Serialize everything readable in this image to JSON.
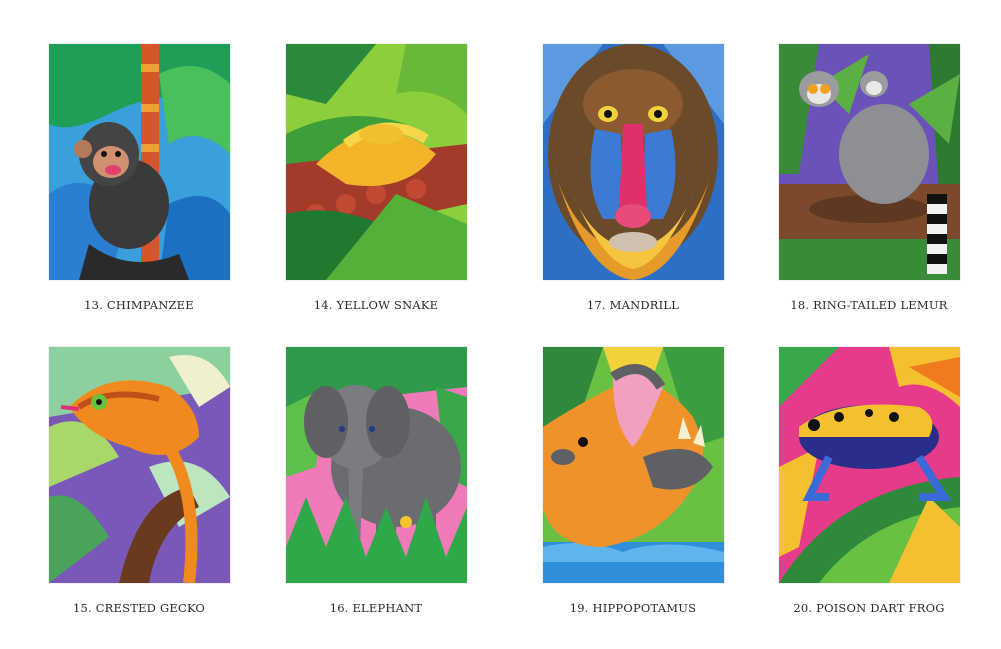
{
  "cards": [
    {
      "number": "13.",
      "title": "CHIMPANZEE"
    },
    {
      "number": "14.",
      "title": "YELLOW SNAKE"
    },
    {
      "number": "17.",
      "title": "MANDRILL"
    },
    {
      "number": "18.",
      "title": "RING-TAILED LEMUR"
    },
    {
      "number": "15.",
      "title": "CRESTED GECKO"
    },
    {
      "number": "16.",
      "title": "ELEPHANT"
    },
    {
      "number": "19.",
      "title": "HIPPOPOTAMUS"
    },
    {
      "number": "20.",
      "title": "POISON DART FROG"
    }
  ]
}
